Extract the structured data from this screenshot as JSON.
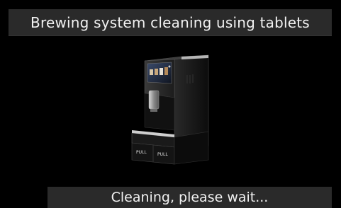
{
  "header": {
    "title": "Brewing system cleaning using tablets"
  },
  "illustration": {
    "icon": "coffee-machine-icon",
    "left_bin_label": "PULL",
    "right_bin_label": "PULL"
  },
  "footer": {
    "status_text": "Cleaning, please wait..."
  },
  "colors": {
    "background": "#000000",
    "bar_background": "#2a2a2a",
    "text": "#f2f2f2"
  }
}
